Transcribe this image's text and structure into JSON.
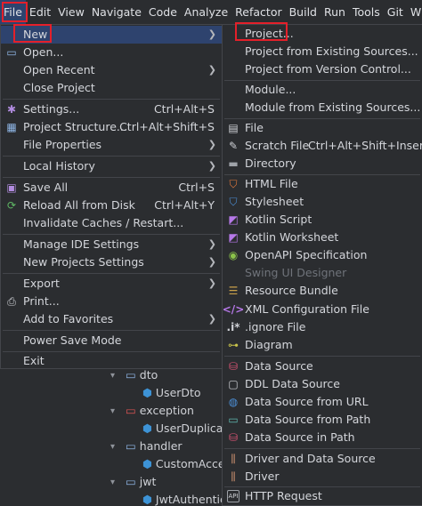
{
  "menubar": {
    "items": [
      "File",
      "Edit",
      "View",
      "Navigate",
      "Code",
      "Analyze",
      "Refactor",
      "Build",
      "Run",
      "Tools",
      "Git",
      "Winc"
    ]
  },
  "file_menu": {
    "new": "New",
    "open": "Open...",
    "open_recent": "Open Recent",
    "close_project": "Close Project",
    "settings": "Settings...",
    "settings_sc": "Ctrl+Alt+S",
    "project_structure": "Project Structure...",
    "project_structure_sc": "Ctrl+Alt+Shift+S",
    "file_properties": "File Properties",
    "local_history": "Local History",
    "save_all": "Save All",
    "save_all_sc": "Ctrl+S",
    "reload": "Reload All from Disk",
    "reload_sc": "Ctrl+Alt+Y",
    "invalidate": "Invalidate Caches / Restart...",
    "manage_ide": "Manage IDE Settings",
    "new_projects_settings": "New Projects Settings",
    "export": "Export",
    "print": "Print...",
    "favorites": "Add to Favorites",
    "power_save": "Power Save Mode",
    "exit": "Exit"
  },
  "new_menu": {
    "project": "Project...",
    "from_existing": "Project from Existing Sources...",
    "from_vcs": "Project from Version Control...",
    "module": "Module...",
    "module_existing": "Module from Existing Sources...",
    "file": "File",
    "scratch": "Scratch File",
    "scratch_sc": "Ctrl+Alt+Shift+Inser",
    "directory": "Directory",
    "html": "HTML File",
    "stylesheet": "Stylesheet",
    "kotlin_script": "Kotlin Script",
    "kotlin_worksheet": "Kotlin Worksheet",
    "openapi": "OpenAPI Specification",
    "swing": "Swing UI Designer",
    "resource_bundle": "Resource Bundle",
    "xml_config": "XML Configuration File",
    "ignore": ".ignore File",
    "diagram": "Diagram",
    "data_source": "Data Source",
    "ddl": "DDL Data Source",
    "ds_url": "Data Source from URL",
    "ds_path": "Data Source from Path",
    "ds_in_path": "Data Source in Path",
    "driver_ds": "Driver and Data Source",
    "driver": "Driver",
    "http": "HTTP Request"
  },
  "tree": {
    "dto": "dto",
    "user_dto": "UserDto",
    "exception": "exception",
    "user_dup": "UserDuplicate",
    "handler": "handler",
    "custom_acc": "CustomAcces",
    "jwt": "jwt",
    "jwt_auth": "JwtAuthentica"
  },
  "colors": {
    "highlight_box": "#e4202a",
    "selection": "#2e436e",
    "background": "#2b2d30"
  }
}
